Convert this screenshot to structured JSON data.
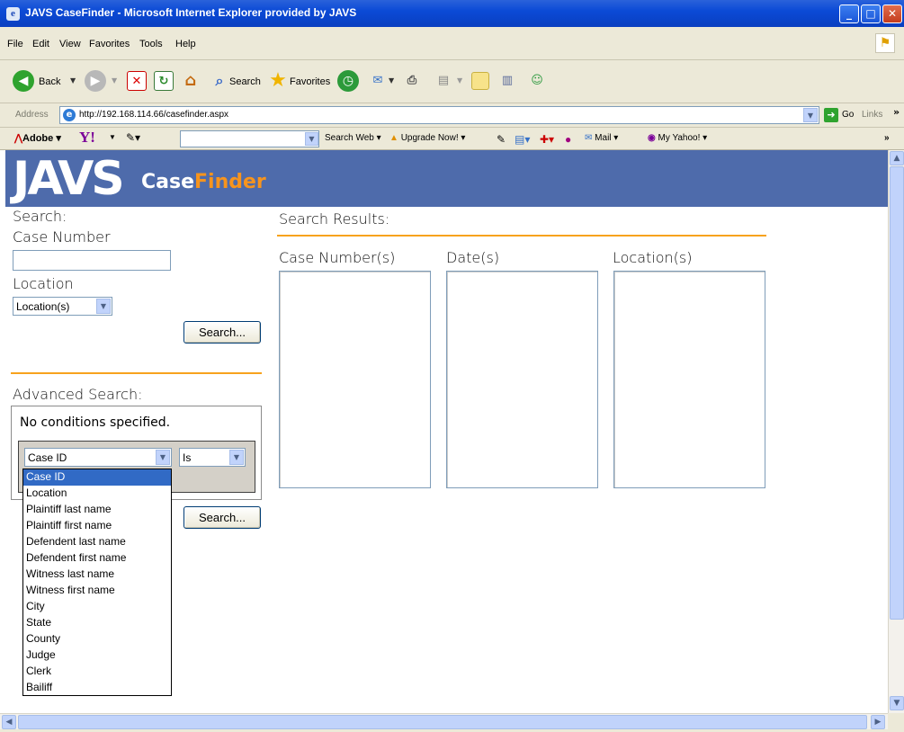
{
  "window": {
    "title": "JAVS CaseFinder - Microsoft Internet Explorer provided by JAVS"
  },
  "menu": [
    "File",
    "Edit",
    "View",
    "Favorites",
    "Tools",
    "Help"
  ],
  "toolbar": {
    "back": "Back",
    "search": "Search",
    "favorites": "Favorites"
  },
  "address": {
    "label": "Address",
    "url": "http://192.168.114.66/casefinder.aspx",
    "go": "Go",
    "links": "Links"
  },
  "yahoo": {
    "adobe": "Adobe",
    "search_web": "Search Web",
    "upgrade": "Upgrade Now!",
    "mail": "Mail",
    "my_yahoo": "My Yahoo!"
  },
  "banner": {
    "logo": "JAVS",
    "product_a": "Case",
    "product_b": "Finder"
  },
  "search": {
    "heading": "Search:",
    "case_number_label": "Case Number",
    "case_number_value": "",
    "location_label": "Location",
    "location_selected": "Location(s)",
    "button": "Search..."
  },
  "advanced": {
    "heading": "Advanced Search:",
    "no_conditions": "No conditions specified.",
    "field_selected": "Case ID",
    "operator_selected": "Is",
    "button": "Search...",
    "field_options": [
      "Case ID",
      "Location",
      "Plaintiff last name",
      "Plaintiff first name",
      "Defendent last name",
      "Defendent first name",
      "Witness last name",
      "Witness first name",
      "City",
      "State",
      "County",
      "Judge",
      "Clerk",
      "Bailiff"
    ]
  },
  "results": {
    "heading": "Search Results:",
    "col_case": "Case Number(s)",
    "col_date": "Date(s)",
    "col_location": "Location(s)"
  },
  "colors": {
    "banner": "#4e6bab",
    "accent_orange": "#f7a21d",
    "titlebar": "#0b4ad6"
  }
}
